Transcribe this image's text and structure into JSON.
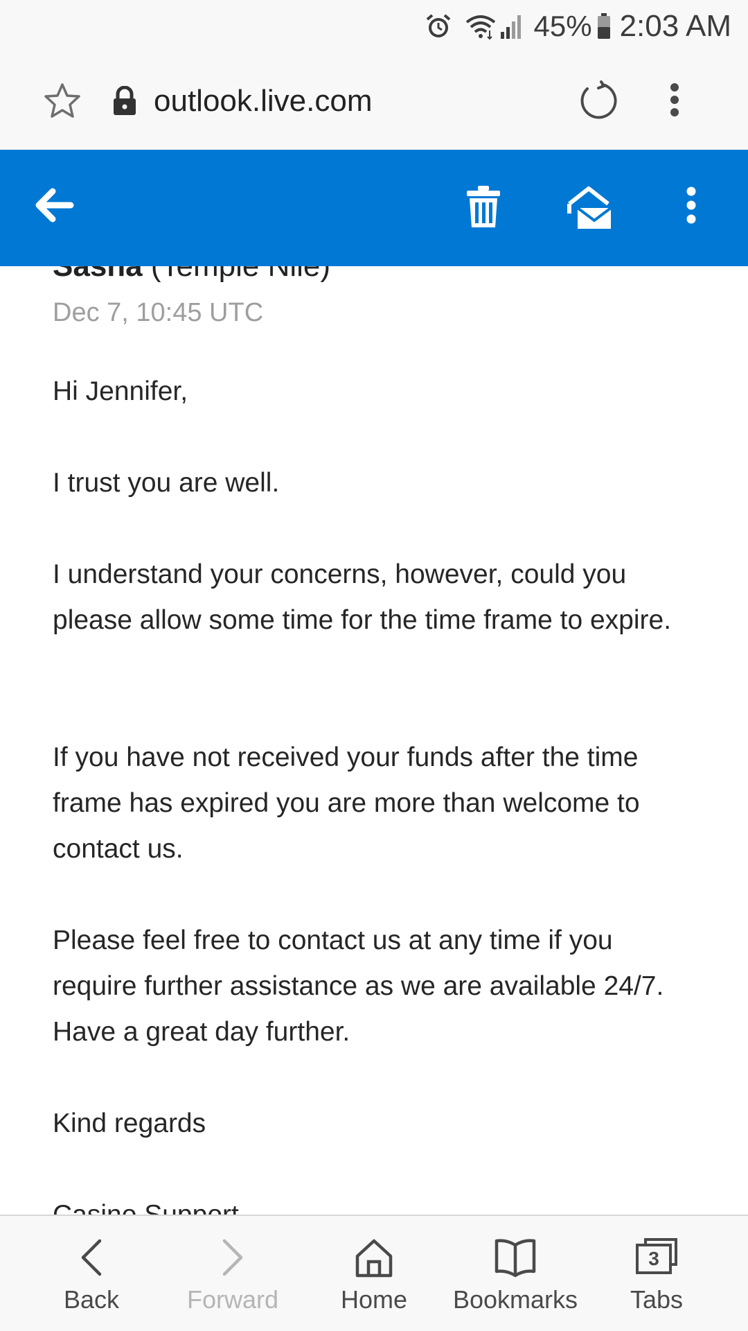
{
  "status_bar": {
    "battery_percent": "45%",
    "time": "2:03 AM",
    "icons": [
      "alarm-icon",
      "wifi-icon",
      "signal-icon",
      "battery-icon"
    ]
  },
  "browser": {
    "url": "outlook.live.com",
    "icons": [
      "star-icon",
      "lock-icon",
      "reload-icon",
      "more-vert-icon"
    ]
  },
  "app_bar": {
    "accent_color": "#0078d4",
    "icons": [
      "back-arrow-icon",
      "trash-icon",
      "mark-read-icon",
      "more-vert-icon"
    ]
  },
  "email": {
    "sender_name": "Sasha",
    "sender_org": "(Temple Nile)",
    "date": "Dec 7, 10:45 UTC",
    "paragraphs": [
      "Hi Jennifer,",
      "I trust you are well.",
      "I understand your concerns, however, could you please allow some time for the time frame to expire.",
      "If you have not received your funds after the time frame has expired you are more than welcome to contact us.",
      "Please feel free to contact us at any time if you require further assistance as we are available 24/7. Have a great day further.",
      "Kind regards",
      "Casino Support"
    ]
  },
  "bottom_nav": {
    "items": [
      {
        "label": "Back",
        "icon": "chevron-left-icon",
        "enabled": true
      },
      {
        "label": "Forward",
        "icon": "chevron-right-icon",
        "enabled": false
      },
      {
        "label": "Home",
        "icon": "home-icon",
        "enabled": true
      },
      {
        "label": "Bookmarks",
        "icon": "bookmarks-icon",
        "enabled": true
      },
      {
        "label": "Tabs",
        "icon": "tabs-icon",
        "enabled": true,
        "count": "3"
      }
    ]
  }
}
